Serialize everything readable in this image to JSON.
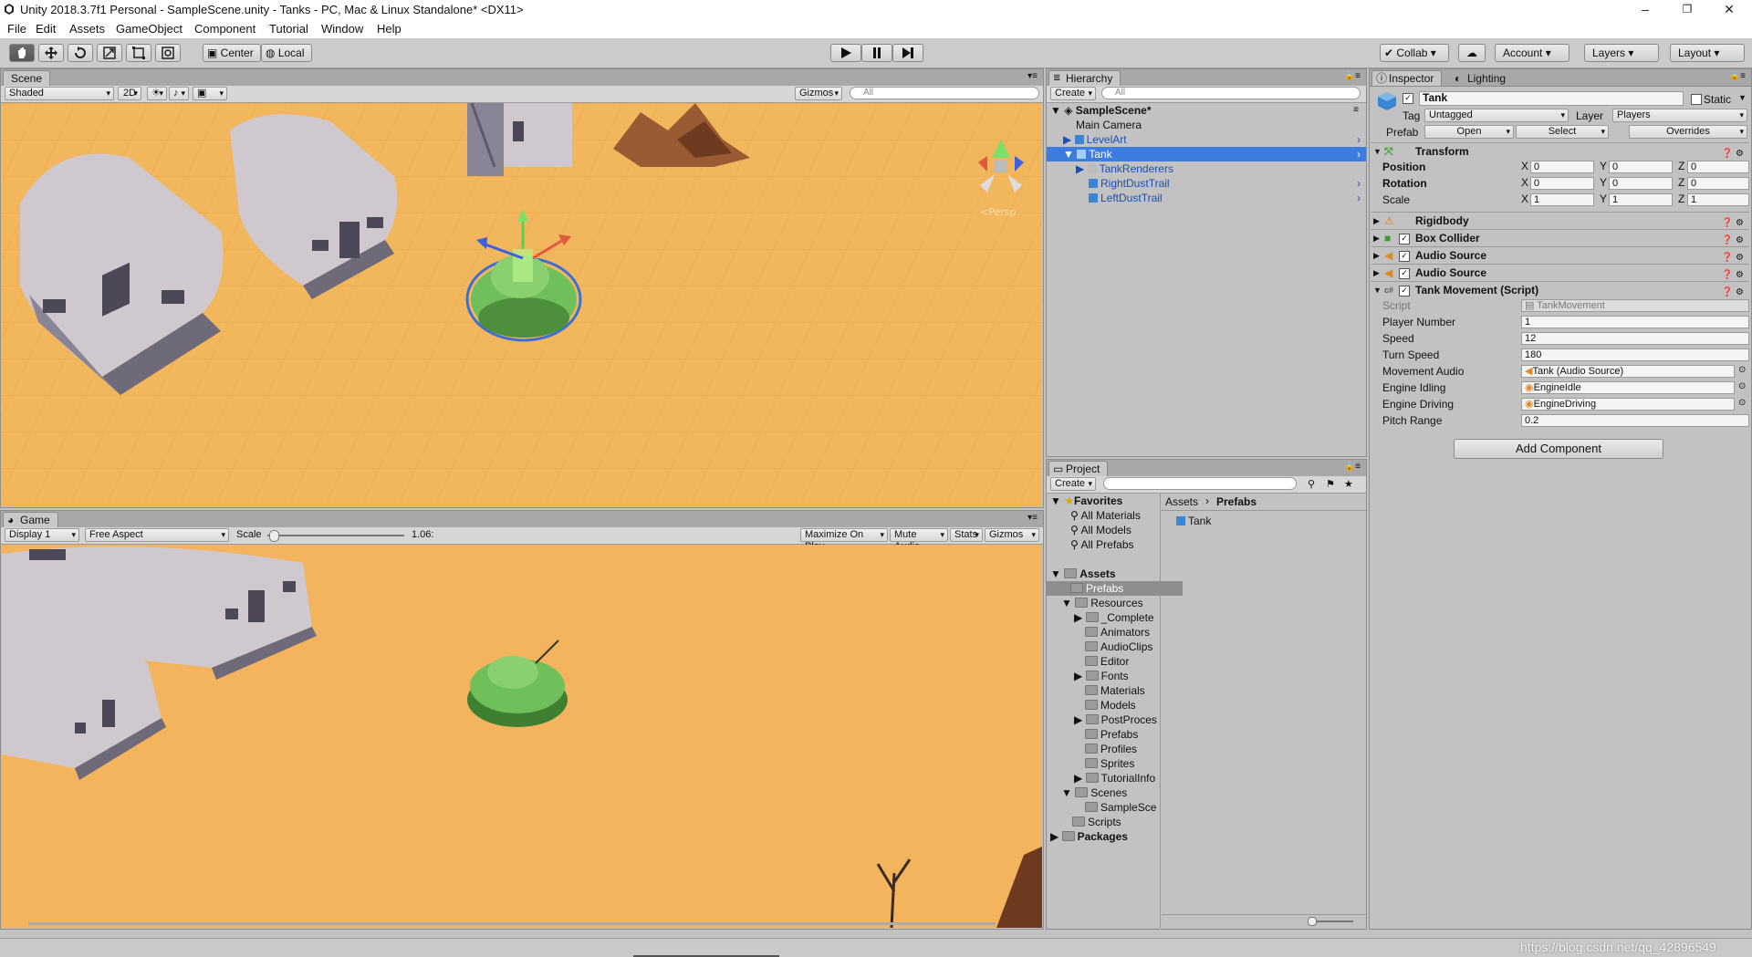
{
  "window": {
    "title": "Unity 2018.3.7f1 Personal - SampleScene.unity - Tanks - PC, Mac & Linux Standalone* <DX11>"
  },
  "menu": [
    "File",
    "Edit",
    "Assets",
    "GameObject",
    "Component",
    "Tutorial",
    "Window",
    "Help"
  ],
  "toolbar": {
    "pivot": "Center",
    "space": "Local",
    "collab": "Collab",
    "account": "Account",
    "layers": "Layers",
    "layout": "Layout"
  },
  "scene": {
    "tab": "Scene",
    "shading": "Shaded",
    "mode2d": "2D",
    "gizmos": "Gizmos",
    "search_placeholder": "All",
    "persp_label": "<Persp"
  },
  "game": {
    "tab": "Game",
    "display": "Display 1",
    "aspect": "Free Aspect",
    "scale_label": "Scale",
    "scale_value": "1.06:",
    "maximize": "Maximize On Play",
    "mute": "Mute Audio",
    "stats": "Stats",
    "gizmos": "Gizmos"
  },
  "hierarchy": {
    "tab": "Hierarchy",
    "create": "Create",
    "search_placeholder": "All",
    "scene": "SampleScene*",
    "items": [
      {
        "label": "Main Camera"
      },
      {
        "label": "LevelArt"
      },
      {
        "label": "Tank"
      },
      {
        "label": "TankRenderers"
      },
      {
        "label": "RightDustTrail"
      },
      {
        "label": "LeftDustTrail"
      }
    ]
  },
  "project": {
    "tab": "Project",
    "create": "Create",
    "favorites": "Favorites",
    "fav_items": [
      "All Materials",
      "All Models",
      "All Prefabs"
    ],
    "assets": "Assets",
    "tree": [
      "Prefabs",
      "Resources",
      "_Complete",
      "Animators",
      "AudioClips",
      "Editor",
      "Fonts",
      "Materials",
      "Models",
      "PostProces",
      "Prefabs",
      "Profiles",
      "Sprites",
      "TutorialInfo",
      "Scenes",
      "SampleSce",
      "Scripts"
    ],
    "packages": "Packages",
    "breadcrumb_root": "Assets",
    "breadcrumb_leaf": "Prefabs",
    "file": "Tank"
  },
  "inspector": {
    "tab": "Inspector",
    "tab2": "Lighting",
    "name": "Tank",
    "static": "Static",
    "tag_label": "Tag",
    "tag": "Untagged",
    "layer_label": "Layer",
    "layer": "Players",
    "prefab_label": "Prefab",
    "open": "Open",
    "select": "Select",
    "overrides": "Overrides",
    "transform": {
      "title": "Transform",
      "rows": [
        {
          "label": "Position",
          "x": "0",
          "y": "0",
          "z": "0"
        },
        {
          "label": "Rotation",
          "x": "0",
          "y": "0",
          "z": "0"
        },
        {
          "label": "Scale",
          "x": "1",
          "y": "1",
          "z": "1"
        }
      ]
    },
    "components": [
      "Rigidbody",
      "Box Collider",
      "Audio Source",
      "Audio Source",
      "Tank Movement (Script)"
    ],
    "script_fields": [
      {
        "label": "Script",
        "value": "TankMovement"
      },
      {
        "label": "Player Number",
        "value": "1"
      },
      {
        "label": "Speed",
        "value": "12"
      },
      {
        "label": "Turn Speed",
        "value": "180"
      },
      {
        "label": "Movement Audio",
        "value": "Tank (Audio Source)"
      },
      {
        "label": "Engine Idling",
        "value": "EngineIdle"
      },
      {
        "label": "Engine Driving",
        "value": "EngineDriving"
      },
      {
        "label": "Pitch Range",
        "value": "0.2"
      }
    ],
    "add_component": "Add Component"
  },
  "watermark": "https://blog.csdn.net/qq_42896549"
}
